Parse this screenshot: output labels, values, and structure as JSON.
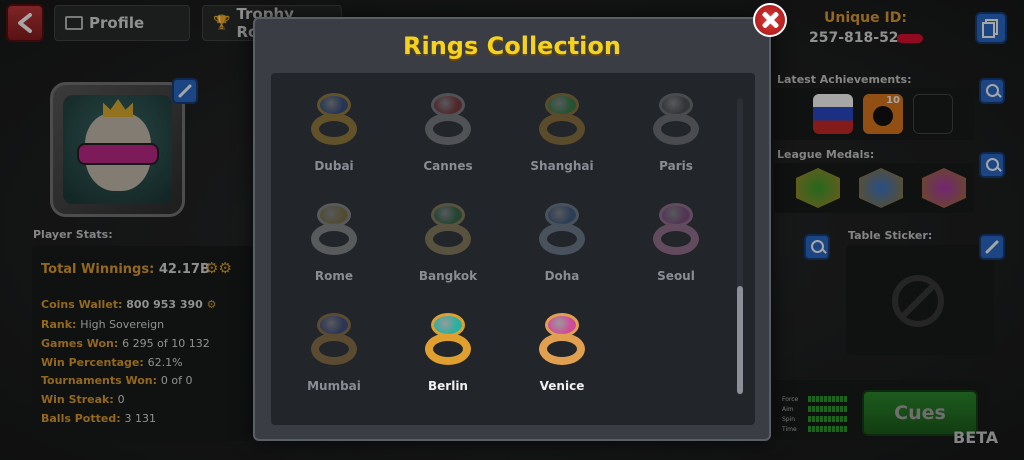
{
  "header": {
    "tabs": [
      {
        "label": "Profile"
      },
      {
        "label": "Trophy Road"
      }
    ],
    "unique_id_label": "Unique ID:",
    "unique_id_value": "257-818-52"
  },
  "stats": {
    "title": "Player Stats:",
    "total_winnings_label": "Total Winnings:",
    "total_winnings_value": "42.17B",
    "rows": [
      {
        "label": "Coins Wallet:",
        "value": "800 953 390"
      },
      {
        "label": "Rank:",
        "value": "High Sovereign"
      },
      {
        "label": "Games Won:",
        "value": "6 295 of 10 132"
      },
      {
        "label": "Win Percentage:",
        "value": "62.1%"
      },
      {
        "label": "Tournaments Won:",
        "value": "0 of 0"
      },
      {
        "label": "Win Streak:",
        "value": "0"
      },
      {
        "label": "Balls Potted:",
        "value": "3 131"
      }
    ]
  },
  "right": {
    "latest_achievements_label": "Latest Achievements:",
    "league_medals_label": "League Medals:",
    "table_sticker_label": "Table Sticker:",
    "achievement_badge_number": "10",
    "cues_label": "Cues",
    "beta_label": "BETA",
    "cue_meters": [
      {
        "label": "Force",
        "level": 10
      },
      {
        "label": "Aim",
        "level": 10
      },
      {
        "label": "Spin",
        "level": 10
      },
      {
        "label": "Time",
        "level": 10
      }
    ]
  },
  "modal": {
    "title": "Rings Collection",
    "rings": [
      {
        "name": "Dubai",
        "owned": false,
        "band": "#b08a2a",
        "gem": "#2a4a8a"
      },
      {
        "name": "Cannes",
        "owned": false,
        "band": "#8a8a8a",
        "gem": "#8a2a2a"
      },
      {
        "name": "Shanghai",
        "owned": false,
        "band": "#a07a2a",
        "gem": "#2a8a3a"
      },
      {
        "name": "Paris",
        "owned": false,
        "band": "#7a7a7a",
        "gem": "#4a4a4a"
      },
      {
        "name": "Rome",
        "owned": false,
        "band": "#9a9a9a",
        "gem": "#8a7a3a"
      },
      {
        "name": "Bangkok",
        "owned": false,
        "band": "#9a8a5a",
        "gem": "#2a6a3a"
      },
      {
        "name": "Doha",
        "owned": false,
        "band": "#7a8a9a",
        "gem": "#3a5a8a"
      },
      {
        "name": "Seoul",
        "owned": false,
        "band": "#b07aa0",
        "gem": "#8a4a8a"
      },
      {
        "name": "Mumbai",
        "owned": false,
        "band": "#a07a3a",
        "gem": "#3a4a8a"
      },
      {
        "name": "Berlin",
        "owned": true,
        "band": "#e0a030",
        "gem": "#2ab0a0"
      },
      {
        "name": "Venice",
        "owned": true,
        "band": "#e0a050",
        "gem": "#d04a9a"
      }
    ]
  }
}
